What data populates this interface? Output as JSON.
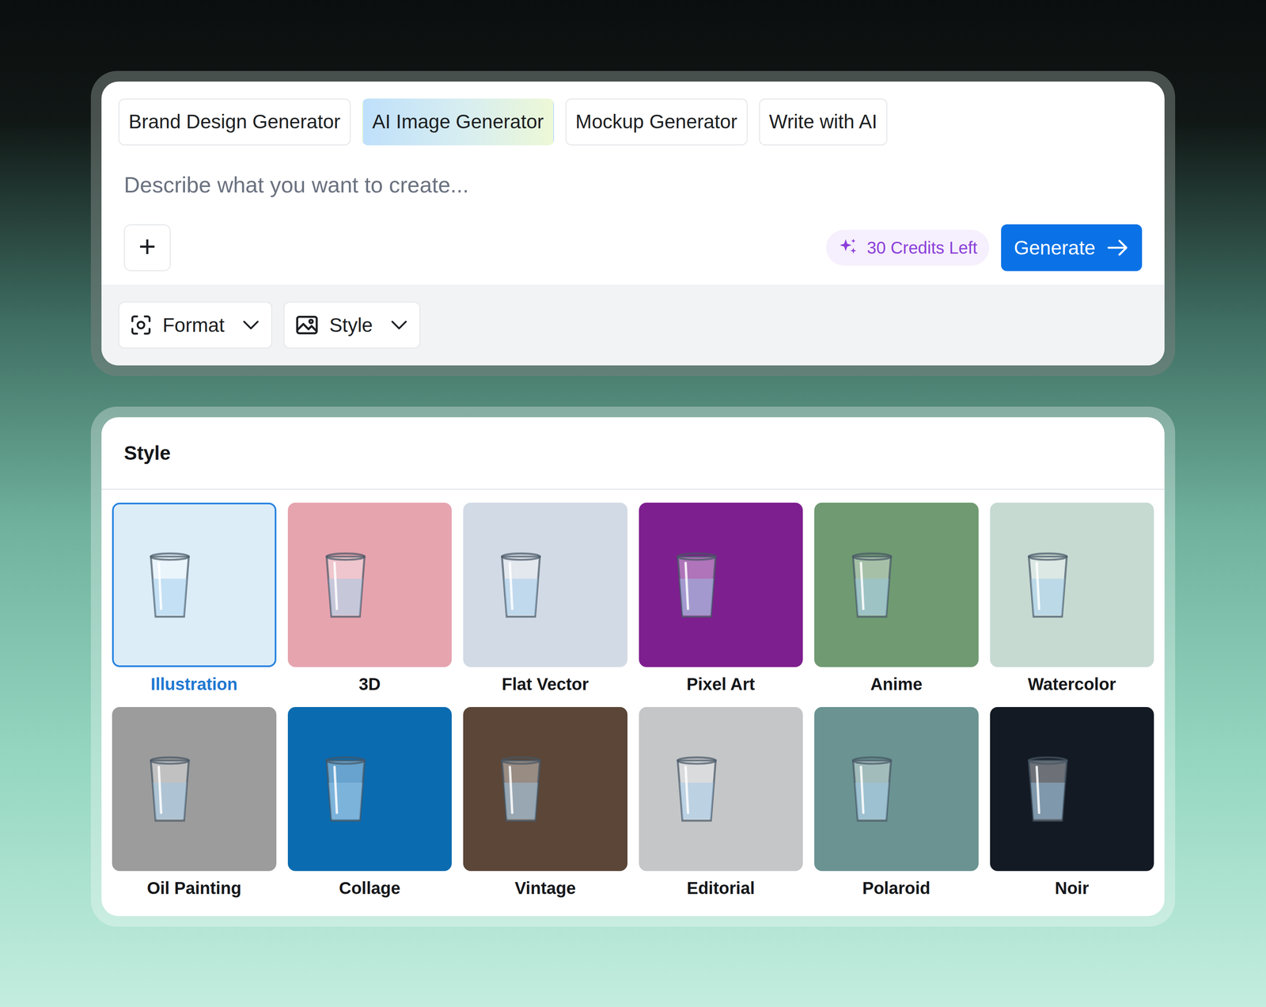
{
  "tabs": [
    {
      "label": "Brand Design Generator",
      "selected": false
    },
    {
      "label": "AI Image Generator",
      "selected": true
    },
    {
      "label": "Mockup Generator",
      "selected": false
    },
    {
      "label": "Write with AI",
      "selected": false
    }
  ],
  "prompt": {
    "placeholder": "Describe what you want to create..."
  },
  "add_button": {
    "label": "+"
  },
  "credits": {
    "label": "30 Credits Left"
  },
  "generate_button": {
    "label": "Generate"
  },
  "options": [
    {
      "label": "Format"
    },
    {
      "label": "Style"
    }
  ],
  "style_panel": {
    "title": "Style",
    "styles": [
      {
        "label": "Illustration",
        "selected": true,
        "color": "#dcedf8"
      },
      {
        "label": "3D",
        "selected": false,
        "color": "#e6a4af"
      },
      {
        "label": "Flat Vector",
        "selected": false,
        "color": "#d2dae5"
      },
      {
        "label": "Pixel Art",
        "selected": false,
        "color": "#7e1f8f"
      },
      {
        "label": "Anime",
        "selected": false,
        "color": "#6f9a72"
      },
      {
        "label": "Watercolor",
        "selected": false,
        "color": "#c6dad2"
      },
      {
        "label": "Oil Painting",
        "selected": false,
        "color": "#9c9c9c"
      },
      {
        "label": "Collage",
        "selected": false,
        "color": "#0b6bb0"
      },
      {
        "label": "Vintage",
        "selected": false,
        "color": "#5b4638"
      },
      {
        "label": "Editorial",
        "selected": false,
        "color": "#c4c6c8"
      },
      {
        "label": "Polaroid",
        "selected": false,
        "color": "#6a9392"
      },
      {
        "label": "Noir",
        "selected": false,
        "color": "#141a24"
      }
    ]
  }
}
